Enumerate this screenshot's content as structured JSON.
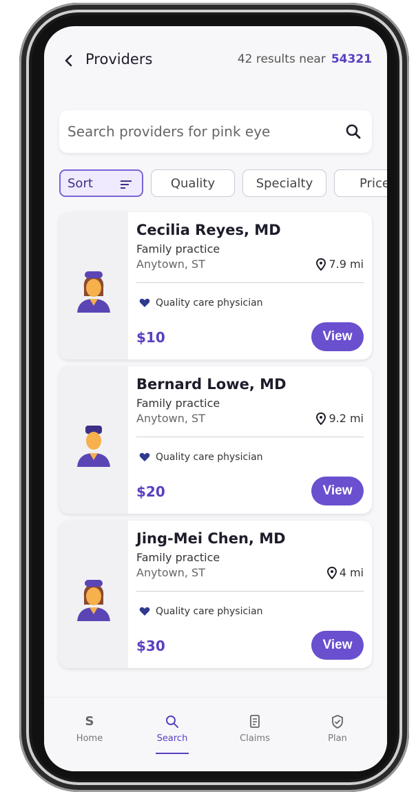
{
  "header": {
    "title": "Providers",
    "results_text": "42 results near",
    "zip": "54321"
  },
  "search": {
    "placeholder": "Search providers for pink eye"
  },
  "filters": {
    "sort": "Sort",
    "quality": "Quality",
    "specialty": "Specialty",
    "price": "Price"
  },
  "providers": [
    {
      "name": "Cecilia Reyes, MD",
      "specialty": "Family practice",
      "location": "Anytown, ST",
      "distance": "7.9 mi",
      "quality": "Quality care physician",
      "price": "$10",
      "view": "View"
    },
    {
      "name": "Bernard Lowe, MD",
      "specialty": "Family practice",
      "location": "Anytown, ST",
      "distance": "9.2 mi",
      "quality": "Quality care physician",
      "price": "$20",
      "view": "View"
    },
    {
      "name": "Jing-Mei Chen, MD",
      "specialty": "Family practice",
      "location": "Anytown, ST",
      "distance": "4 mi",
      "quality": "Quality care physician",
      "price": "$30",
      "view": "View"
    }
  ],
  "nav": {
    "home": "Home",
    "search": "Search",
    "claims": "Claims",
    "plan": "Plan",
    "home_glyph": "S"
  },
  "colors": {
    "accent": "#6a4fcf",
    "heart": "#2f3a8f"
  }
}
